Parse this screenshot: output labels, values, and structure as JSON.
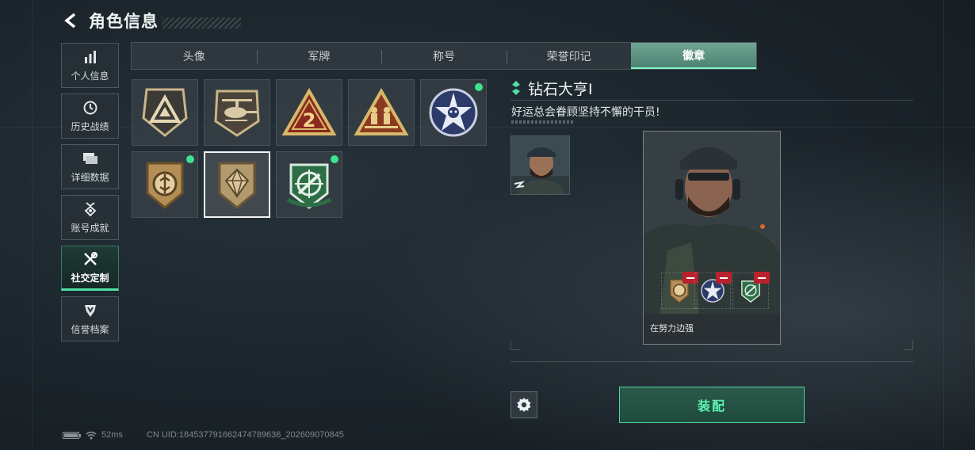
{
  "header": {
    "title": "角色信息"
  },
  "sidebar": {
    "items": [
      {
        "label": "个人信息",
        "icon": "bar-chart-icon"
      },
      {
        "label": "历史战绩",
        "icon": "clock-icon"
      },
      {
        "label": "详细数据",
        "icon": "folder-icon"
      },
      {
        "label": "账号成就",
        "icon": "medal-icon"
      },
      {
        "label": "社交定制",
        "icon": "tools-icon",
        "active": true
      },
      {
        "label": "信誉档案",
        "icon": "shield-badge-icon"
      }
    ]
  },
  "tabs": [
    {
      "label": "头像"
    },
    {
      "label": "军牌"
    },
    {
      "label": "称号"
    },
    {
      "label": "荣誉印记"
    },
    {
      "label": "徽章",
      "active": true
    }
  ],
  "badges": [
    {
      "icon": "delta-badge-icon"
    },
    {
      "icon": "helicopter-badge-icon"
    },
    {
      "icon": "number-two-badge-icon"
    },
    {
      "icon": "soldiers-badge-icon"
    },
    {
      "icon": "skull-star-badge-icon",
      "new": true
    },
    {
      "icon": "coin-badge-icon",
      "new": true
    },
    {
      "icon": "diamond-shield-badge-icon",
      "selected": true
    },
    {
      "icon": "green-crosshair-badge-icon",
      "new": true
    }
  ],
  "detail": {
    "name": "钻石大亨Ⅰ",
    "description": "好运总会眷顾坚持不懈的干员!",
    "card_caption": "在努力边强"
  },
  "actions": {
    "equip": "装配"
  },
  "status": {
    "ping": "52ms",
    "uid": "CN UID:184537791662474789636_202609070845"
  },
  "colors": {
    "accent": "#4fe0a6",
    "new_dot": "#3ee38f",
    "remove": "#b8222c"
  }
}
